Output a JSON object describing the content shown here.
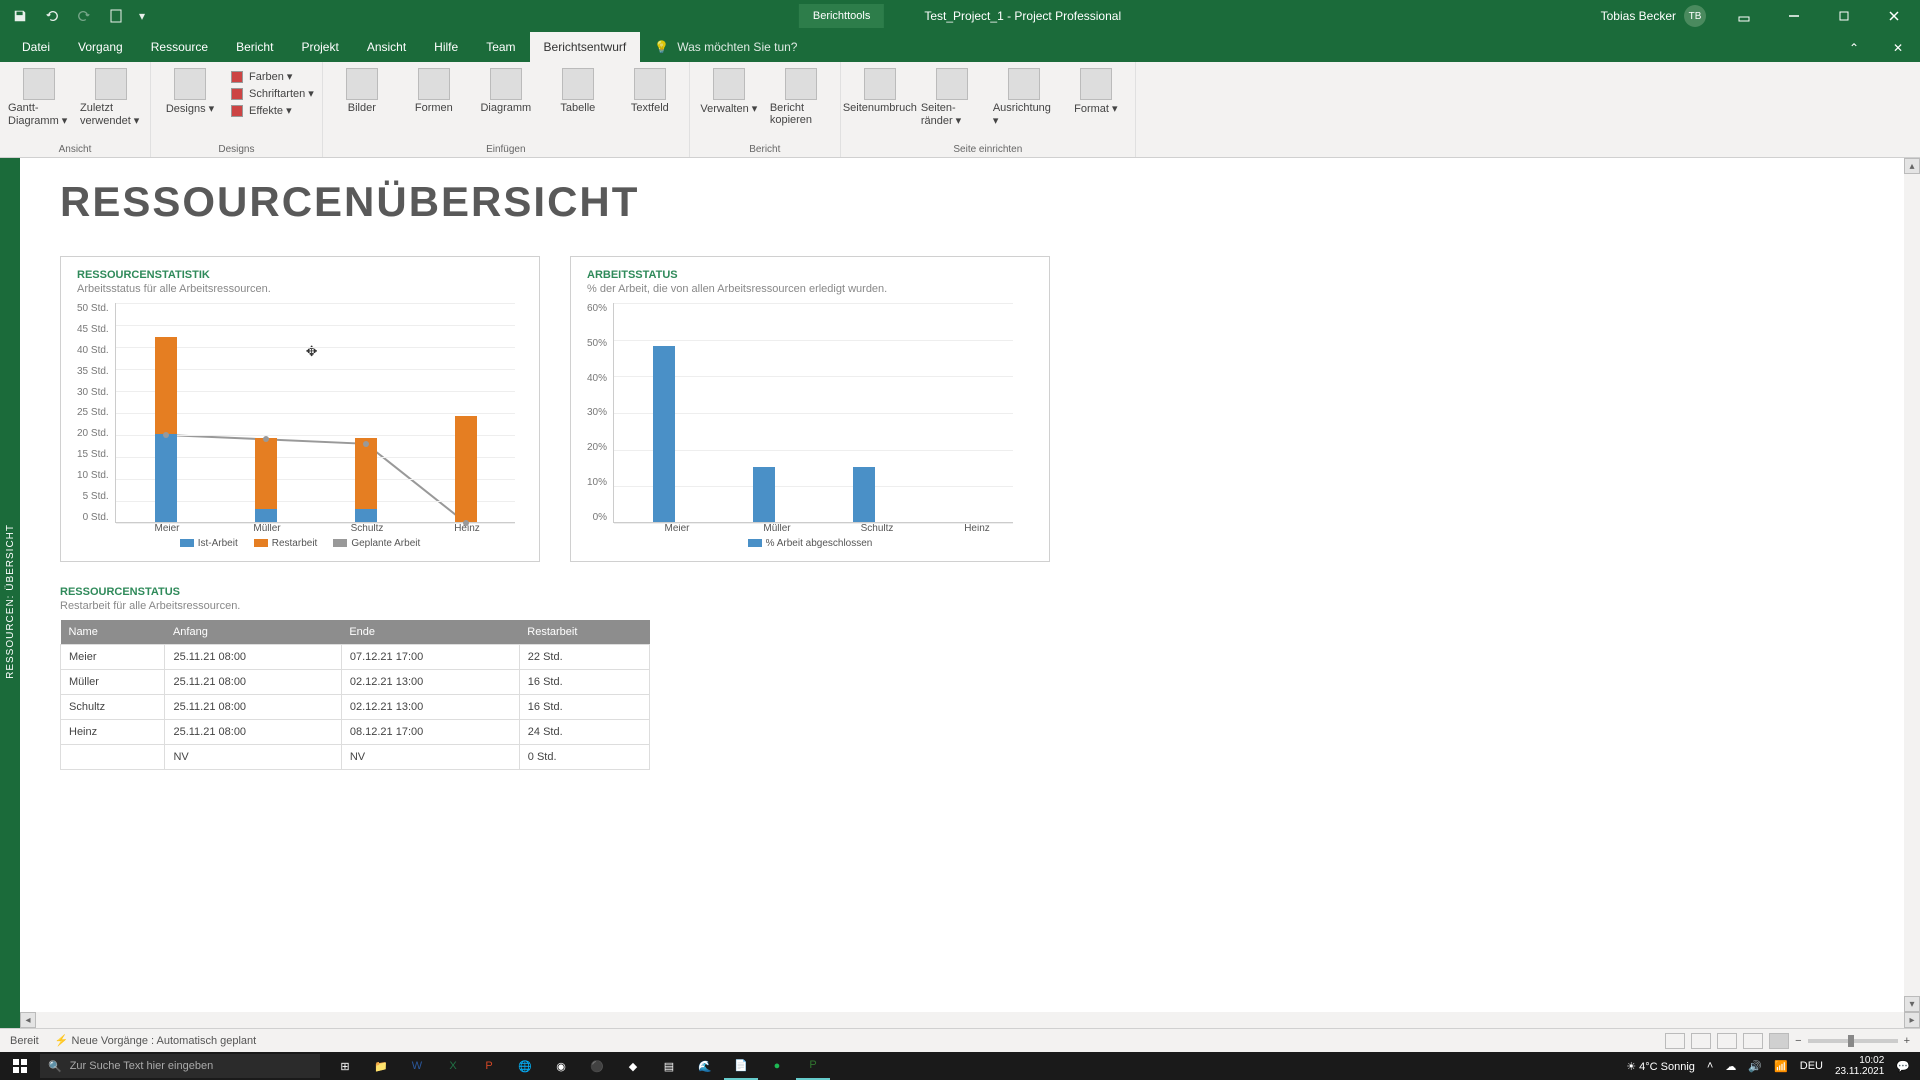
{
  "titlebar": {
    "tool_context": "Berichttools",
    "doc_title": "Test_Project_1  -  Project Professional",
    "user_name": "Tobias Becker",
    "user_initials": "TB"
  },
  "menu": {
    "items": [
      "Datei",
      "Vorgang",
      "Ressource",
      "Bericht",
      "Projekt",
      "Ansicht",
      "Hilfe",
      "Team",
      "Berichtsentwurf"
    ],
    "active_index": 8,
    "tell_me": "Was möchten Sie tun?"
  },
  "ribbon": {
    "groups": [
      {
        "label": "Ansicht",
        "big": [
          {
            "name": "gantt-diagramm",
            "label": "Gantt-Diagramm ▾"
          },
          {
            "name": "zuletzt-verwendet",
            "label": "Zuletzt verwendet ▾"
          }
        ]
      },
      {
        "label": "Designs",
        "big": [
          {
            "name": "designs",
            "label": "Designs ▾"
          }
        ],
        "small": [
          {
            "name": "farben",
            "label": "Farben ▾"
          },
          {
            "name": "schriftarten",
            "label": "Schriftarten ▾"
          },
          {
            "name": "effekte",
            "label": "Effekte ▾"
          }
        ]
      },
      {
        "label": "Einfügen",
        "big": [
          {
            "name": "bilder",
            "label": "Bilder"
          },
          {
            "name": "formen",
            "label": "Formen"
          },
          {
            "name": "diagramm",
            "label": "Diagramm"
          },
          {
            "name": "tabelle",
            "label": "Tabelle"
          },
          {
            "name": "textfeld",
            "label": "Textfeld"
          }
        ]
      },
      {
        "label": "Bericht",
        "big": [
          {
            "name": "verwalten",
            "label": "Verwalten ▾"
          },
          {
            "name": "bericht-kopieren",
            "label": "Bericht kopieren"
          }
        ]
      },
      {
        "label": "Seite einrichten",
        "big": [
          {
            "name": "seitenumbruch",
            "label": "Seitenumbruch"
          },
          {
            "name": "seitenraender",
            "label": "Seiten-ränder ▾"
          },
          {
            "name": "ausrichtung",
            "label": "Ausrichtung ▾"
          },
          {
            "name": "format-btn",
            "label": "Format ▾"
          }
        ]
      }
    ]
  },
  "side_rail": "RESSOURCEN: ÜBERSICHT",
  "page": {
    "title": "RESSOURCENÜBERSICHT",
    "chart1": {
      "title": "RESSOURCENSTATISTIK",
      "subtitle": "Arbeitsstatus für alle Arbeitsressourcen."
    },
    "chart2": {
      "title": "ARBEITSSTATUS",
      "subtitle": "% der Arbeit, die von allen Arbeitsressourcen erledigt wurden."
    },
    "table": {
      "title": "RESSOURCENSTATUS",
      "subtitle": "Restarbeit für alle Arbeitsressourcen."
    }
  },
  "chart_data": [
    {
      "type": "bar",
      "title": "RESSOURCENSTATISTIK",
      "categories": [
        "Meier",
        "Müller",
        "Schultz",
        "Heinz"
      ],
      "series": [
        {
          "name": "Ist-Arbeit",
          "values": [
            20,
            3,
            3,
            0
          ],
          "color": "#4a90c7"
        },
        {
          "name": "Restarbeit",
          "values": [
            22,
            16,
            16,
            24
          ],
          "color": "#e57e22"
        }
      ],
      "line_series": {
        "name": "Geplante Arbeit",
        "values": [
          20,
          19,
          18,
          0
        ],
        "color": "#999999"
      },
      "y_ticks": [
        "0 Std.",
        "5 Std.",
        "10 Std.",
        "15 Std.",
        "20 Std.",
        "25 Std.",
        "30 Std.",
        "35 Std.",
        "40 Std.",
        "45 Std.",
        "50 Std."
      ],
      "ylim": [
        0,
        50
      ]
    },
    {
      "type": "bar",
      "title": "ARBEITSSTATUS",
      "categories": [
        "Meier",
        "Müller",
        "Schultz",
        "Heinz"
      ],
      "series": [
        {
          "name": "% Arbeit abgeschlossen",
          "values": [
            48,
            15,
            15,
            0
          ],
          "color": "#4a90c7"
        }
      ],
      "y_ticks": [
        "0%",
        "10%",
        "20%",
        "30%",
        "40%",
        "50%",
        "60%"
      ],
      "ylim": [
        0,
        60
      ]
    }
  ],
  "table_data": {
    "headers": [
      "Name",
      "Anfang",
      "Ende",
      "Restarbeit"
    ],
    "rows": [
      [
        "Meier",
        "25.11.21 08:00",
        "07.12.21 17:00",
        "22 Std."
      ],
      [
        "Müller",
        "25.11.21 08:00",
        "02.12.21 13:00",
        "16 Std."
      ],
      [
        "Schultz",
        "25.11.21 08:00",
        "02.12.21 13:00",
        "16 Std."
      ],
      [
        "Heinz",
        "25.11.21 08:00",
        "08.12.21 17:00",
        "24 Std."
      ],
      [
        "",
        "NV",
        "NV",
        "0 Std."
      ]
    ]
  },
  "statusbar": {
    "left1": "Bereit",
    "left2": "Neue Vorgänge : Automatisch geplant"
  },
  "taskbar": {
    "search_placeholder": "Zur Suche Text hier eingeben",
    "weather": "4°C  Sonnig",
    "lang": "DEU",
    "time": "10:02",
    "date": "23.11.2021"
  }
}
